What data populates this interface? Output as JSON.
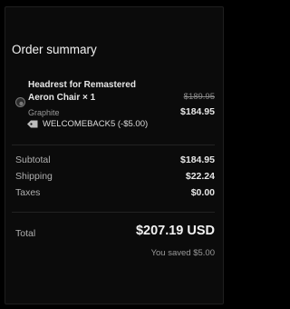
{
  "summary": {
    "title": "Order summary",
    "item": {
      "name": "Headrest for Remastered Aeron Chair × 1",
      "variant": "Graphite",
      "original_price": "$189.95",
      "price": "$184.95",
      "discount": "WELCOMEBACK5 (-$5.00)"
    },
    "subtotal_label": "Subtotal",
    "subtotal_value": "$184.95",
    "shipping_label": "Shipping",
    "shipping_value": "$22.24",
    "taxes_label": "Taxes",
    "taxes_value": "$0.00",
    "total_label": "Total",
    "total_value": "$207.19 USD",
    "saved": "You saved $5.00"
  },
  "icons": {
    "discount": "tag-icon",
    "product": "product-thumbnail"
  },
  "colors": {
    "background": "#0b0b0b",
    "text": "#e6e6e6",
    "muted": "#9a9a9a"
  }
}
